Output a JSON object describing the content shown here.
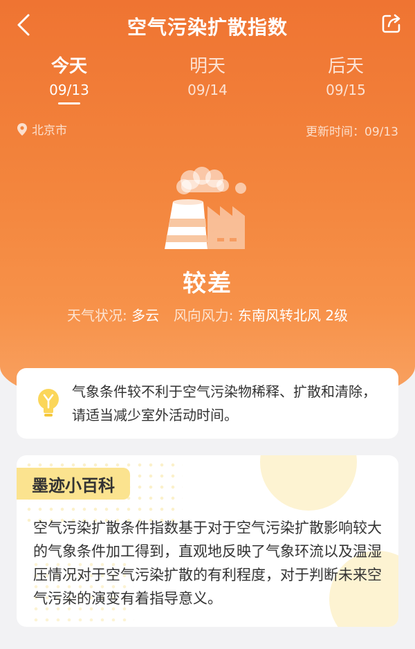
{
  "header": {
    "title": "空气污染扩散指数"
  },
  "tabs": [
    {
      "label": "今天",
      "date": "09/13"
    },
    {
      "label": "明天",
      "date": "09/14"
    },
    {
      "label": "后天",
      "date": "09/15"
    }
  ],
  "location": {
    "city": "北京市",
    "update_time": "更新时间：09/13"
  },
  "status": {
    "level": "较差",
    "weather_label": "天气状况:",
    "weather_value": "多云",
    "wind_label": "风向风力:",
    "wind_value": "东南风转北风 2级"
  },
  "tip": {
    "icon": "lightbulb-icon",
    "text": "气象条件较不利于空气污染物稀释、扩散和清除，请适当减少室外活动时间。"
  },
  "wiki": {
    "badge": "墨迹小百科",
    "text": "空气污染扩散条件指数基于对于空气污染扩散影响较大的气象条件加工得到，直观地反映了气象环流以及温湿压情况对于空气污染扩散的有利程度，对于判断未来空气污染的演变有着指导意义。"
  },
  "colors": {
    "accent": "#ef7432",
    "badge": "#fbe38f"
  }
}
